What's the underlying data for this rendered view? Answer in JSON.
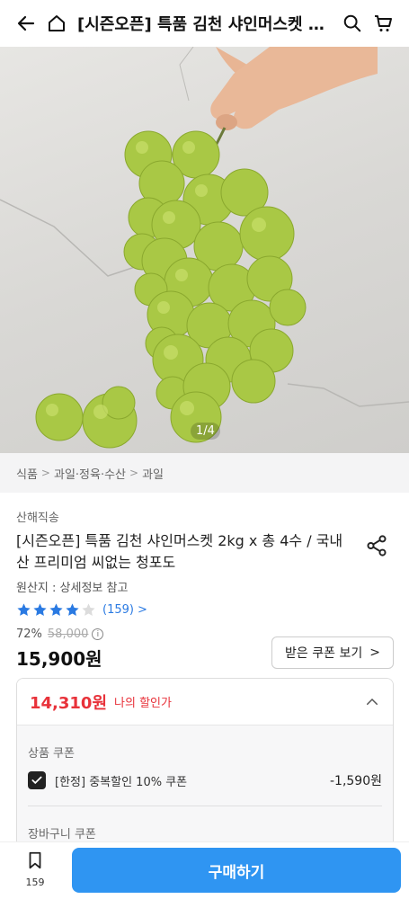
{
  "header": {
    "title": "[시즌오픈] 특품 김천 샤인머스켓 2kg x 총 4수 / 국내산 프리미엄 씨없는 청포도",
    "icons": [
      "back-arrow-icon",
      "home-icon",
      "search-icon",
      "cart-icon"
    ]
  },
  "hero": {
    "counter": "1/4"
  },
  "breadcrumb": [
    "식품",
    "과일·정육·수산",
    "과일"
  ],
  "product": {
    "seller": "산해직송",
    "title": "[시즌오픈] 특품 김천 샤인머스켓 2kg x 총 4수 / 국내산 프리미엄 씨없는 청포도",
    "origin": "원산지 : 상세정보 참고",
    "rating_stars": 4,
    "rating_count": "(159)",
    "discount_pct": "72%",
    "original_price": "58,000",
    "price": "15,900원",
    "coupon_button": "받은 쿠폰 보기"
  },
  "discount_panel": {
    "my_price": "14,310원",
    "my_label": "나의 할인가",
    "product_coupon_title": "상품 쿠폰",
    "coupon_label": "[한정] 중복할인 10% 쿠폰",
    "coupon_amount": "-1,590원",
    "cart_coupon_title": "장바구니 쿠폰"
  },
  "bottom_bar": {
    "wish_count": "159",
    "buy_label": "구매하기"
  },
  "colors": {
    "accent": "#2f95f2",
    "sale": "#e8323a",
    "star": "#2a7ae2"
  }
}
